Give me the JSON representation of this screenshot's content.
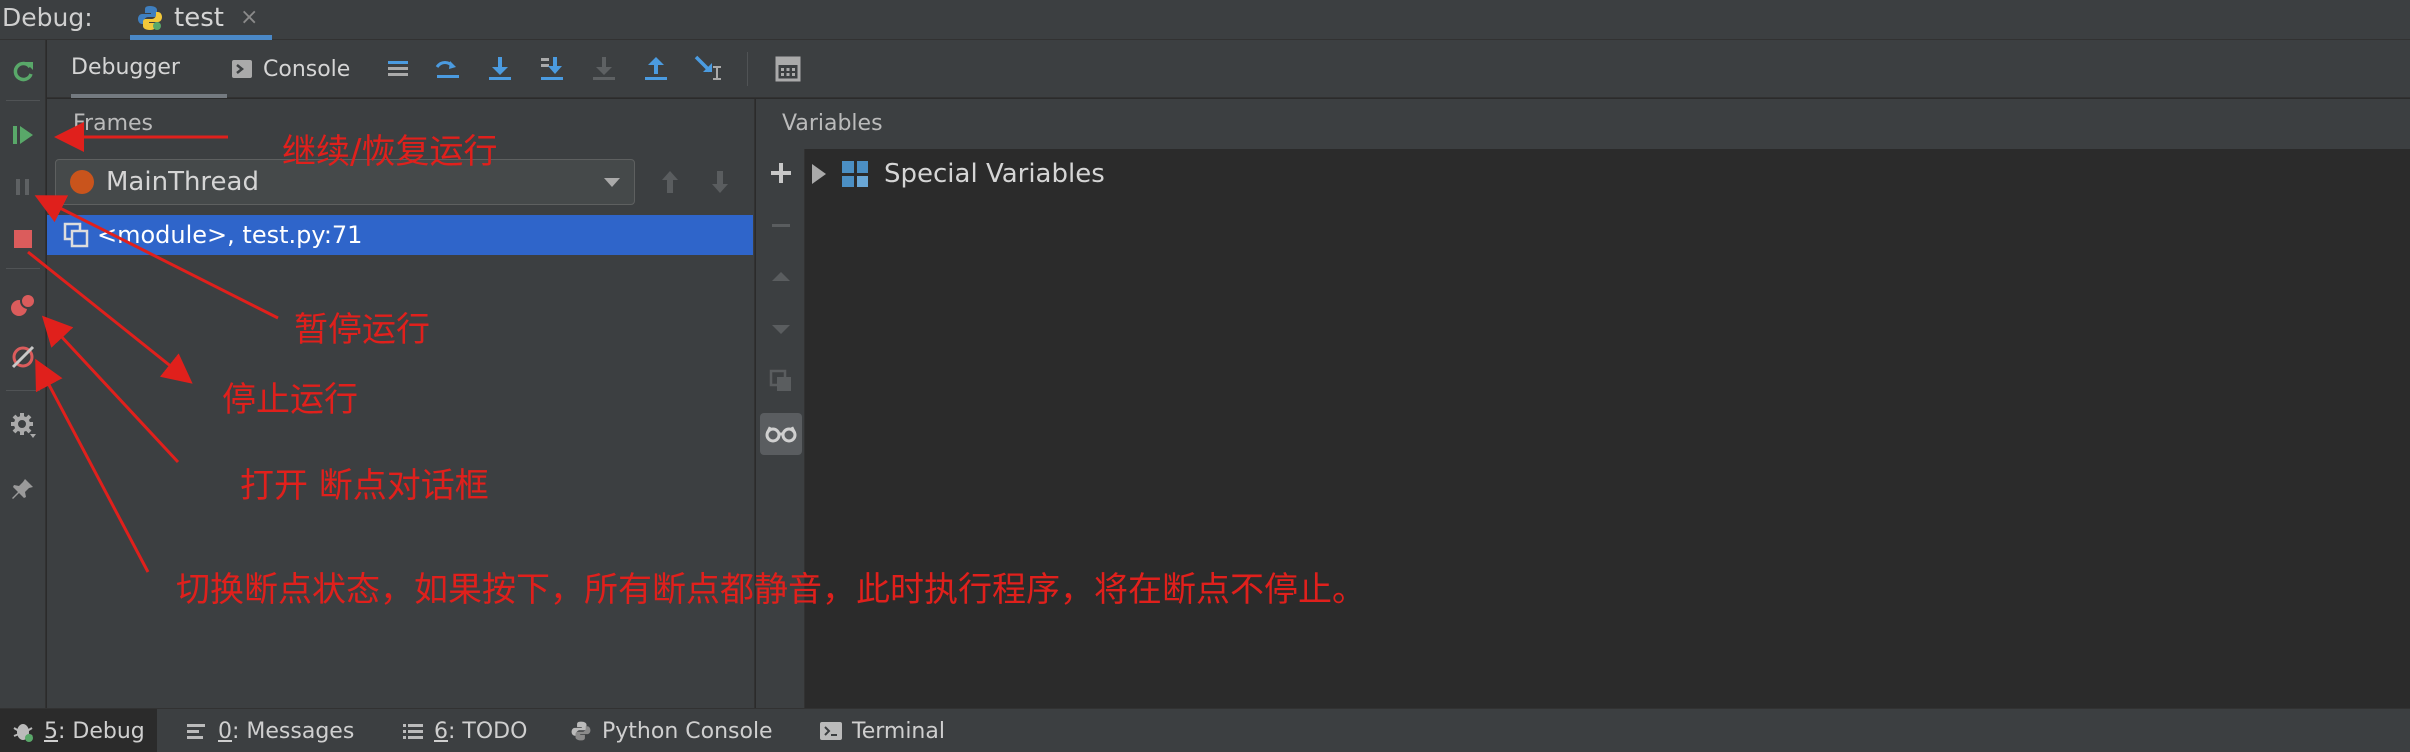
{
  "titlebar": {
    "label": "Debug:",
    "tab_name": "test",
    "tab_close": "×"
  },
  "toolbar": {
    "tab_debugger": "Debugger",
    "tab_console": "Console"
  },
  "frames": {
    "header": "Frames",
    "thread": "MainThread",
    "frame_row": "<module>, test.py:71"
  },
  "variables": {
    "header": "Variables",
    "item": "Special Variables"
  },
  "statusbar": {
    "debug_num": "5",
    "debug_label": ": Debug",
    "messages_num": "0",
    "messages_label": ": Messages",
    "todo_num": "6",
    "todo_label": ": TODO",
    "python_console": "Python Console",
    "terminal": "Terminal"
  },
  "annotations": {
    "resume": "继续/恢复运行",
    "pause": "暂停运行",
    "stop": "停止运行",
    "breakpoints": "打开 断点对话框",
    "mute": "切换断点状态，如果按下，所有断点都静音，此时执行程序，将在断点不停止。"
  },
  "colors": {
    "annotation_red": "#e0201c",
    "selection_blue": "#2f65ca",
    "thread_dot": "#c9541c",
    "rerun_green": "#59a869",
    "stop_red": "#db5c5c"
  }
}
